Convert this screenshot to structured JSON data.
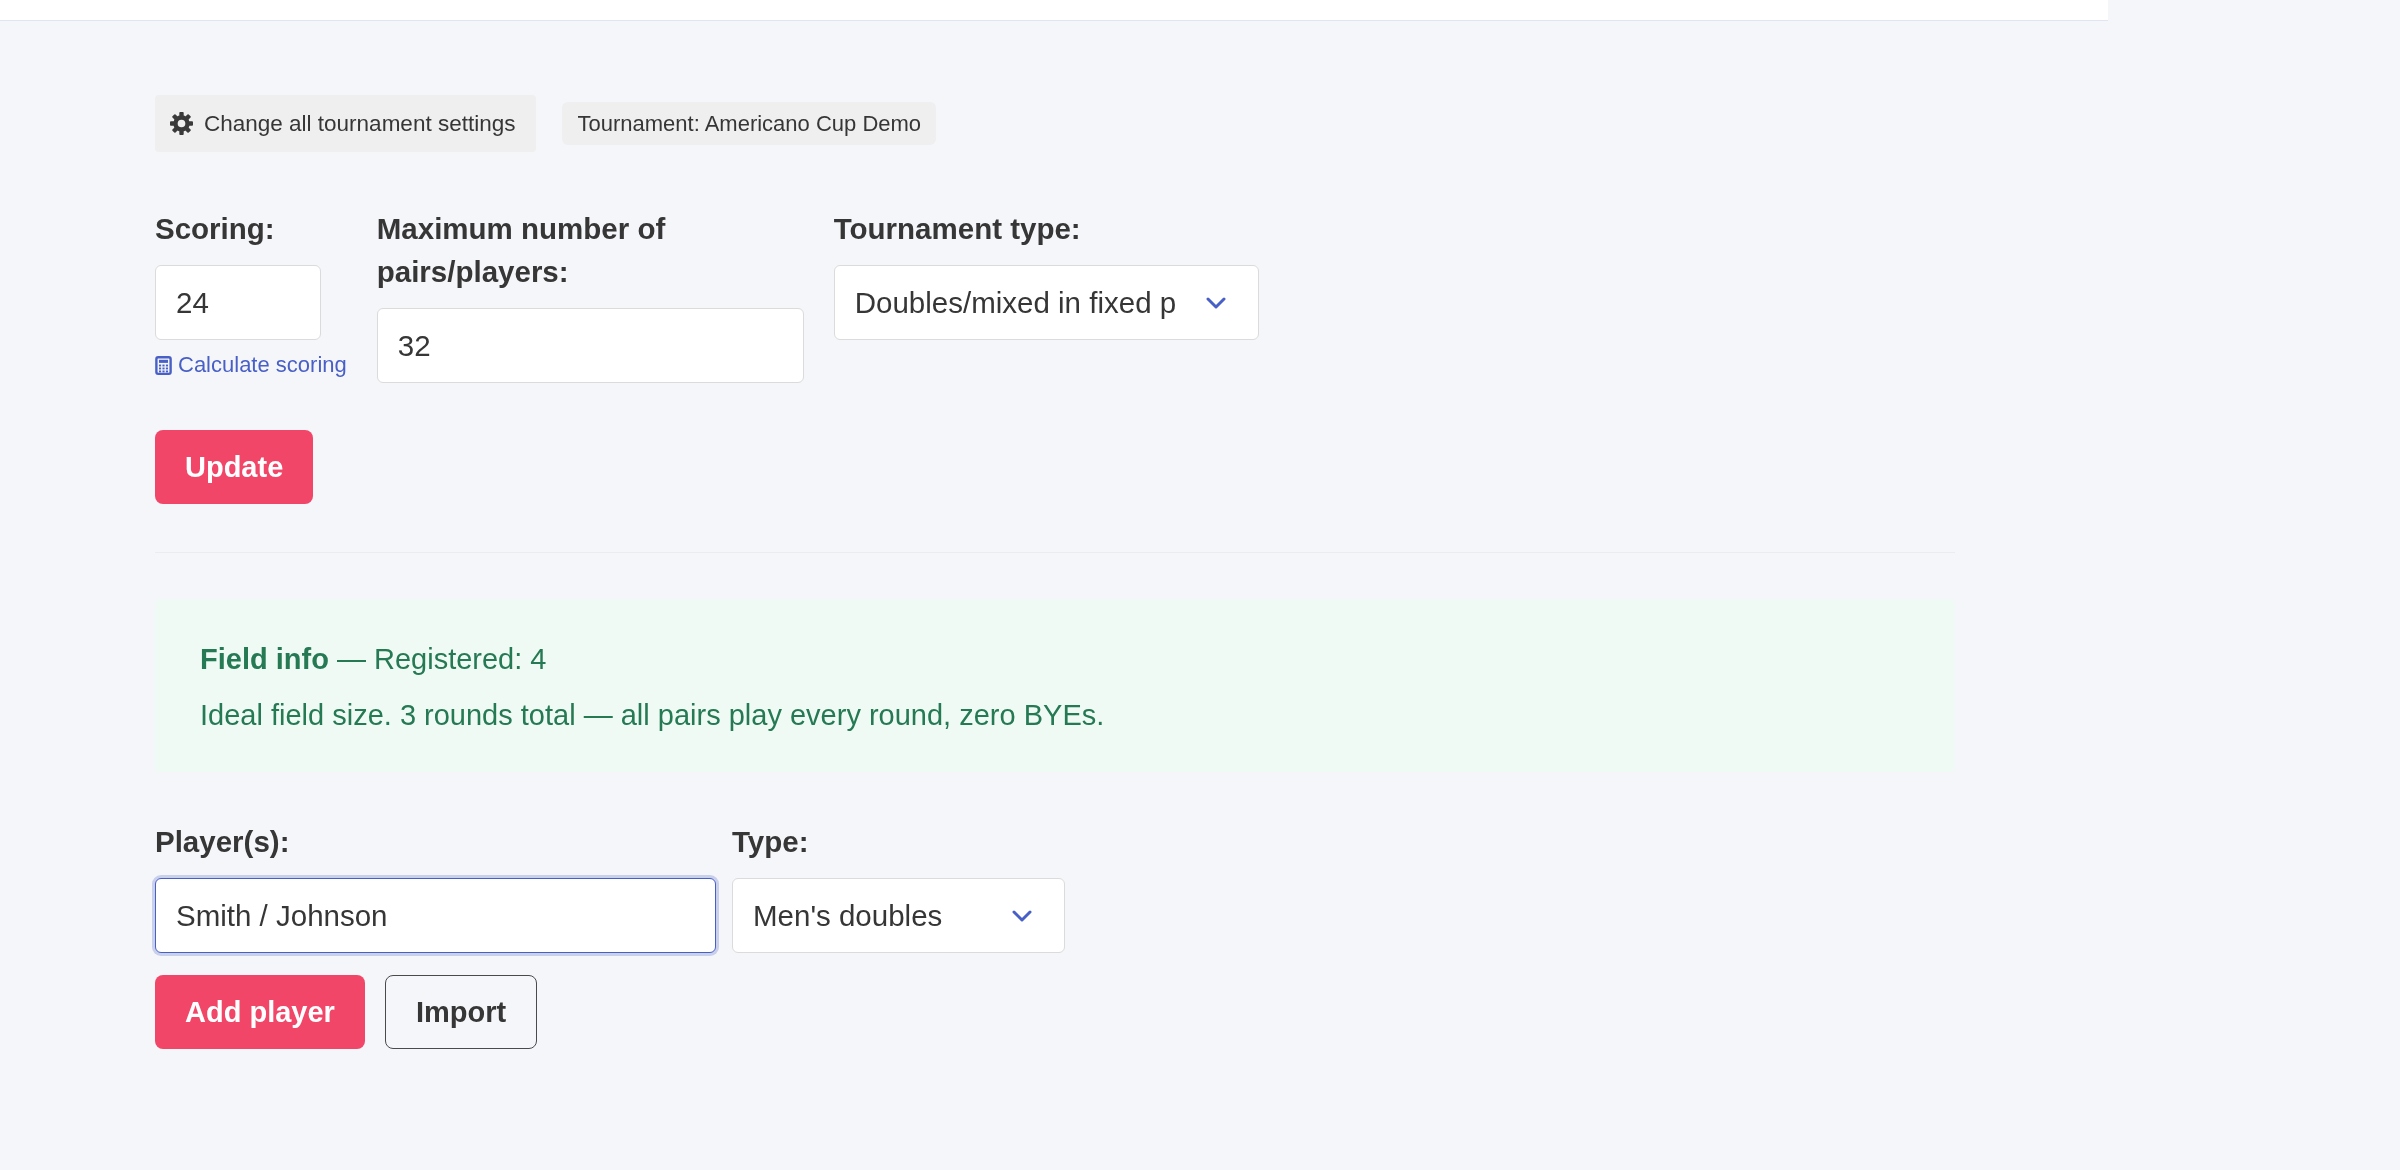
{
  "toolbar": {
    "settings_button": "Change all tournament settings",
    "tournament_tag": "Tournament: Americano Cup Demo"
  },
  "settings_form": {
    "fields": [
      {
        "kind": "input",
        "label": "Scoring:",
        "value": "24",
        "link": "Calculate scoring"
      },
      {
        "kind": "input",
        "label": "Maximum number of pairs/players:",
        "value": "32"
      },
      {
        "kind": "select",
        "label": "Tournament type:",
        "value": "Doubles/mixed in fixed p"
      }
    ],
    "submit_button": "Update"
  },
  "field_info": {
    "heading": "**Field info** — Registered: 4",
    "message": "Ideal field size. 3 rounds total — all pairs play every round, zero BYEs."
  },
  "player_form": {
    "fields": [
      {
        "kind": "input",
        "label": "Player(s):",
        "value": "Smith / Johnson",
        "focused": true
      },
      {
        "kind": "select",
        "label": "Type:",
        "value": "Men's doubles",
        "focused": false
      }
    ],
    "buttons": [
      {
        "kind": "primary",
        "label": "Add player"
      },
      {
        "kind": "outline",
        "label": "Import"
      }
    ]
  }
}
